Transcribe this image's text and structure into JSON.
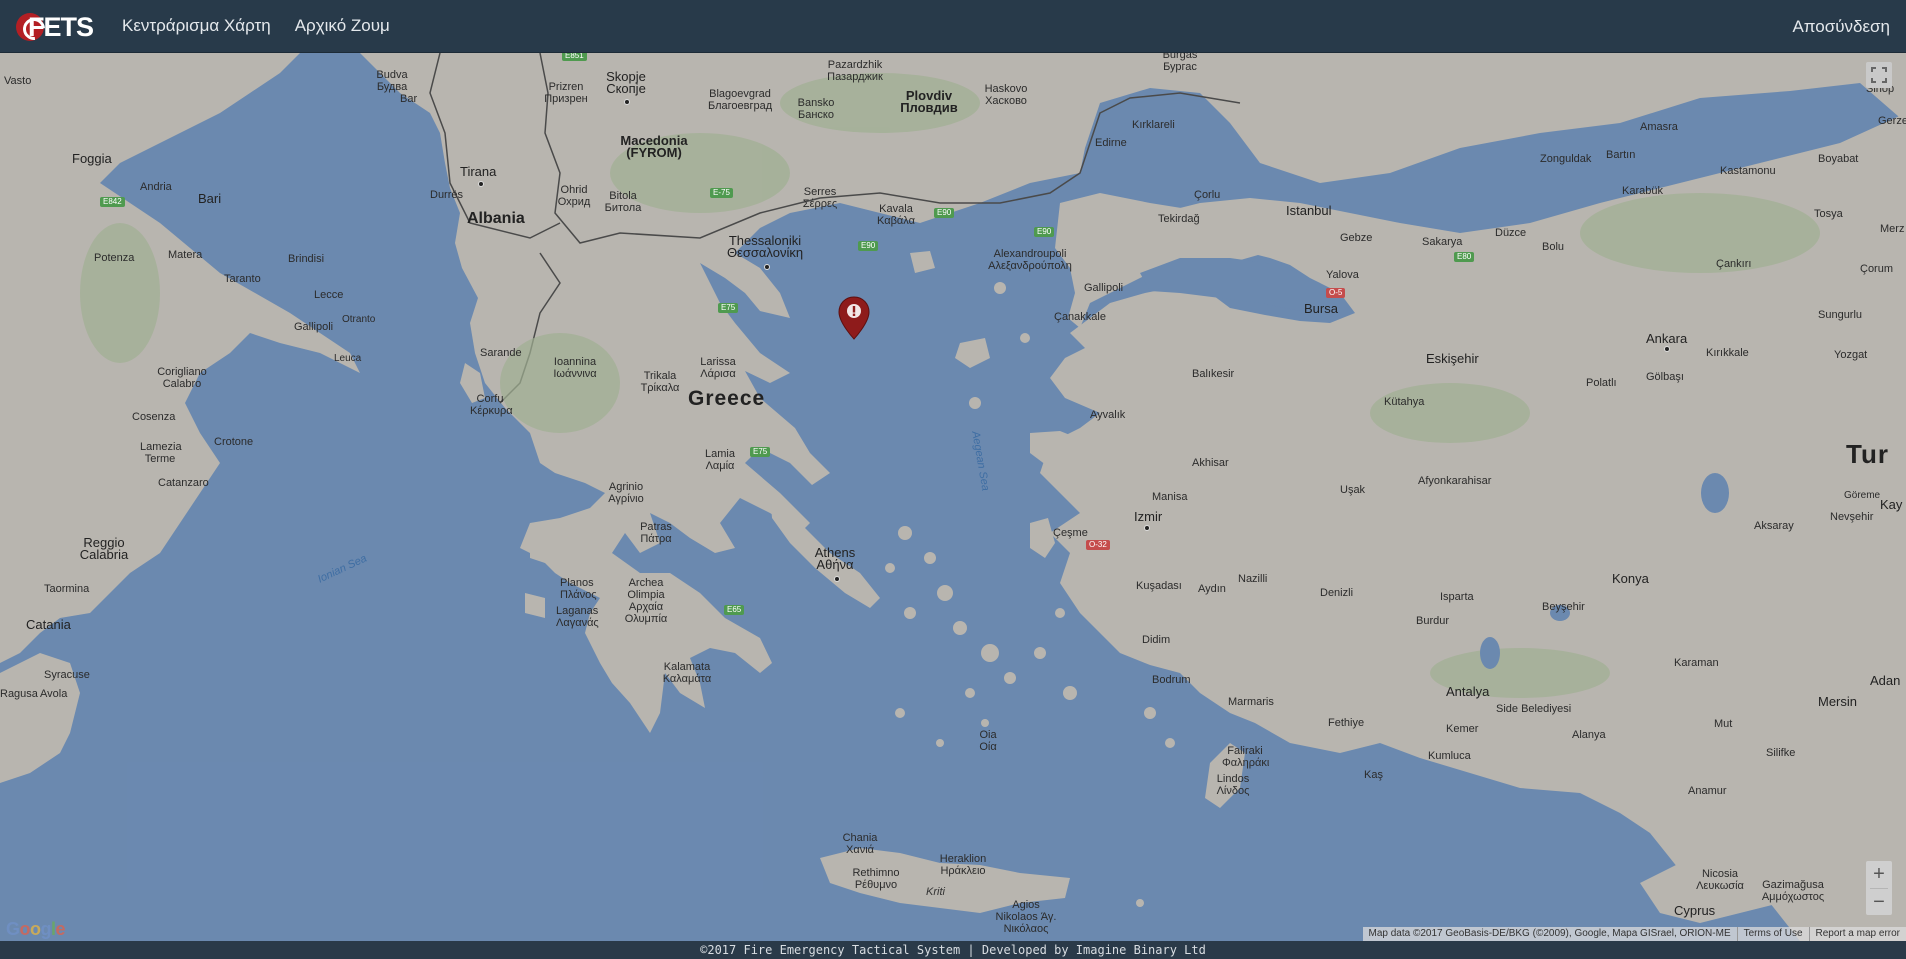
{
  "nav": {
    "brand": "FETS",
    "center_map": "Κεντράρισμα Χάρτη",
    "initial_zoom": "Αρχικό Ζουμ",
    "logout": "Αποσύνδεση"
  },
  "map": {
    "countries": {
      "greece": "Greece",
      "albania": "Albania",
      "macedonia": "Macedonia (FYROM)",
      "turkey": "Tur"
    },
    "seas": {
      "aegean": "Aegean Sea",
      "ionian": "Ionian Sea"
    },
    "cities": {
      "skopje": "Skopje Скопје",
      "prizren": "Prizren Призрен",
      "tirana": "Tirana",
      "durres": "Durrës",
      "ohrid": "Ohrid Охрид",
      "bitola": "Bitola Битола",
      "blagoevgrad": "Blagoevgrad Благоевград",
      "plovdiv": "Plovdiv Пловдив",
      "haskovo": "Haskovo Хасково",
      "pazardzhik": "Pazardzhik Пазарджик",
      "bansko": "Bansko Банско",
      "burgas": "Burgas Бургас",
      "kirklareli": "Kırklareli",
      "edirne": "Edirne",
      "thessaloniki": "Thessaloniki Θεσσαλονίκη",
      "serres": "Serres Σέρρες",
      "kavala": "Kavala Καβάλα",
      "alexandroupoli": "Alexandroupoli Αλεξανδρούπολη",
      "ioannina": "Ioannina Ιωάννινα",
      "trikala": "Trikala Τρίκαλα",
      "larissa": "Larissa Λάρισα",
      "lamia": "Lamia Λαμία",
      "agrinio": "Agrinio Αγρίνιο",
      "patras": "Patras Πάτρα",
      "athens": "Athens Αθήνα",
      "kalamata": "Kalamata Καλαμάτα",
      "archea_olimpia": "Archea Olimpia Αρχαία Ολυμπία",
      "planos": "Planos Πλάνος",
      "laganas": "Laganas Λαγανάς",
      "corfu": "Corfu Κέρκυρα",
      "sarande": "Sarande",
      "chania": "Chania Χανιά",
      "rethimno": "Rethimno Ρέθυμνο",
      "heraklion": "Heraklion Ηράκλειο",
      "kriti": "Kriti",
      "agios_nikolaos": "Agios Nikolaos Άγ. Νικόλαος",
      "oia": "Oia Οία",
      "lindos": "Lindos Λίνδος",
      "faliraki": "Faliraki Φαληράκι",
      "istanbul": "Istanbul",
      "tekirdag": "Tekirdağ",
      "corlu": "Çorlu",
      "gebze": "Gebze",
      "yalova": "Yalova",
      "bursa": "Bursa",
      "sakarya": "Sakarya",
      "duzce": "Düzce",
      "bolu": "Bolu",
      "zonguldak": "Zonguldak",
      "bartin": "Bartın",
      "karabuk": "Karabük",
      "kastamonu": "Kastamonu",
      "amasra": "Amasra",
      "boyabat": "Boyabat",
      "tosya": "Tosya",
      "cankiri": "Çankırı",
      "corum": "Çorum",
      "sungurlu": "Sungurlu",
      "ankara": "Ankara",
      "kirikkale": "Kırıkkale",
      "yozgat": "Yozgat",
      "polatli": "Polatlı",
      "golbasi": "Gölbaşı",
      "eskisehir": "Eskişehir",
      "kutahya": "Kütahya",
      "balikesir": "Balıkesir",
      "canakkale": "Çanakkale",
      "gallipoli_tr": "Gallipoli",
      "ayvalik": "Ayvalık",
      "akhisar": "Akhisar",
      "manisa": "Manisa",
      "izmir": "Izmir",
      "cesme": "Çeşme",
      "usak": "Uşak",
      "afyonkarahisar": "Afyonkarahisar",
      "kusadasi": "Kuşadası",
      "aydin": "Aydın",
      "nazilli": "Nazilli",
      "denizli": "Denizli",
      "didim": "Didim",
      "bodrum": "Bodrum",
      "marmaris": "Marmaris",
      "fethiye": "Fethiye",
      "kas": "Kaş",
      "kumluca": "Kumluca",
      "kemer": "Kemer",
      "antalya": "Antalya",
      "side": "Side Belediyesi",
      "alanya": "Alanya",
      "anamur": "Anamur",
      "isparta": "Isparta",
      "burdur": "Burdur",
      "beysehir": "Beyşehir",
      "konya": "Konya",
      "aksaray": "Aksaray",
      "nevsehir": "Nevşehir",
      "goreme": "Göreme",
      "karaman": "Karaman",
      "mut": "Mut",
      "silifke": "Silifke",
      "mersin": "Mersin",
      "adana": "Adan",
      "kay": "Kay",
      "nicosia": "Nicosia Λευκωσία",
      "cyprus": "Cyprus",
      "famagusta": "Gazimağusa Αμμόχωστος",
      "sinop": "Sinop",
      "gerze": "Gerze",
      "merz": "Merz",
      "bari": "Bari",
      "foggia": "Foggia",
      "andria": "Andria",
      "brindisi": "Brindisi",
      "lecce": "Lecce",
      "taranto": "Taranto",
      "matera": "Matera",
      "potenza": "Potenza",
      "gallipoli_it": "Gallipoli",
      "otranto": "Otranto",
      "leuca": "Leuca",
      "corigliano": "Corigliano Calabro",
      "cosenza": "Cosenza",
      "crotone": "Crotone",
      "lamezia": "Lamezia Terme",
      "catanzaro": "Catanzaro",
      "reggio": "Reggio Calabria",
      "taormina": "Taormina",
      "catania": "Catania",
      "siracusa": "Syracuse",
      "avola": "Avola",
      "ragusa": "Ragusa",
      "vasto": "Vasto",
      "budva": "Budva Будва",
      "bar_me": "Bar"
    },
    "roads": [
      "E851",
      "E-75",
      "E90",
      "E90",
      "E90",
      "E75",
      "E75",
      "E65",
      "E842",
      "E80",
      "O-5",
      "O-32"
    ],
    "fullscreen_icon": "fullscreen-icon",
    "zoom_in": "+",
    "zoom_out": "−",
    "google": [
      "G",
      "o",
      "o",
      "g",
      "l",
      "e"
    ],
    "attribution": {
      "data": "Map data ©2017 GeoBasis-DE/BKG (©2009), Google, Mapa GISrael, ORION-ME",
      "terms": "Terms of Use",
      "report": "Report a map error"
    }
  },
  "footer": "©2017 Fire Emergency Tactical System | Developed by Imagine Binary Ltd"
}
